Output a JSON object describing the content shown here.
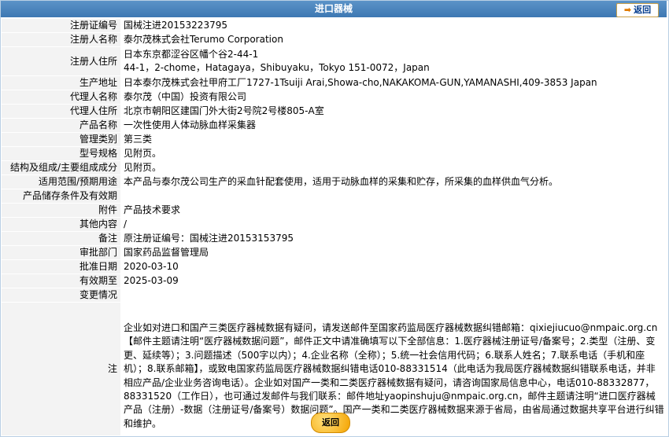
{
  "header": {
    "title": "进口器械",
    "back_label": "返回"
  },
  "rows": [
    {
      "label": "注册证编号",
      "value": "国械注进20153223795"
    },
    {
      "label": "注册人名称",
      "value": "泰尔茂株式会社Terumo Corporation"
    },
    {
      "label": "注册人住所",
      "value": "日本东京都涩谷区幡个谷2-44-1",
      "value2": "44-1，2-chome，Hatagaya，Shibuyaku，Tokyo 151-0072，Japan"
    },
    {
      "label": "生产地址",
      "value": "日本泰尔茂株式会社甲府工厂1727-1Tsuiji Arai,Showa-cho,NAKAKOMA-GUN,YAMANASHI,409-3853 Japan"
    },
    {
      "label": "代理人名称",
      "value": "泰尔茂（中国）投资有限公司"
    },
    {
      "label": "代理人住所",
      "value": "北京市朝阳区建国门外大街2号院2号楼805-A室"
    },
    {
      "label": "产品名称",
      "value": "一次性使用人体动脉血样采集器"
    },
    {
      "label": "管理类别",
      "value": "第三类"
    },
    {
      "label": "型号规格",
      "value": "见附页。"
    },
    {
      "label": "结构及组成/主要组成成分",
      "value": "见附页。"
    },
    {
      "label": "适用范围/预期用途",
      "value": "本产品与泰尔茂公司生产的采血针配套使用，适用于动脉血样的采集和贮存，所采集的血样供血气分析。"
    },
    {
      "label": "产品储存条件及有效期",
      "value": ""
    },
    {
      "label": "附件",
      "value": "产品技术要求"
    },
    {
      "label": "其他内容",
      "value": "/"
    },
    {
      "label": "备注",
      "value": "原注册证编号：国械注进20153153795"
    },
    {
      "label": "审批部门",
      "value": "国家药品监督管理局"
    },
    {
      "label": "批准日期",
      "value": "2020-03-10"
    },
    {
      "label": "有效期至",
      "value": "2025-03-09"
    },
    {
      "label": "变更情况",
      "value": ""
    }
  ],
  "note": {
    "label": "注",
    "text": "企业如对进口和国产三类医疗器械数据有疑问，请发送邮件至国家药监局医疗器械数据纠错邮箱：qixiejiucuo@nmpaic.org.cn【邮件主题请注明“医疗器械数据问题”，邮件正文中请准确填写以下全部信息：1.医疗器械注册证号/备案号；2.类型（注册、变更、延续等）；3.问题描述（500字以内）；4.企业名称（全称）；5.统一社会信用代码；6.联系人姓名；7.联系电话（手机和座机）；8.联系邮箱】，或致电国家药监局医疗器械数据纠错电话010-88331514（此电话为我局医疗器械数据纠错联系电话，并非相应产品/企业业务咨询电话）。企业如对国产一类和二类医疗器械数据有疑问，请咨询国家局信息中心，电话010-88332877，88331520（工作日），也可通过发邮件与我们联系：邮件地址yaopinshuju@nmpaic.org.cn，邮件主题请注明“进口医疗器械产品（注册）-数据（注册证号/备案号）数据问题”。国产一类和二类医疗器械数据来源于省局，由省局通过数据共享平台进行纠错和维护。"
  },
  "footer": {
    "back_label": "返回"
  }
}
